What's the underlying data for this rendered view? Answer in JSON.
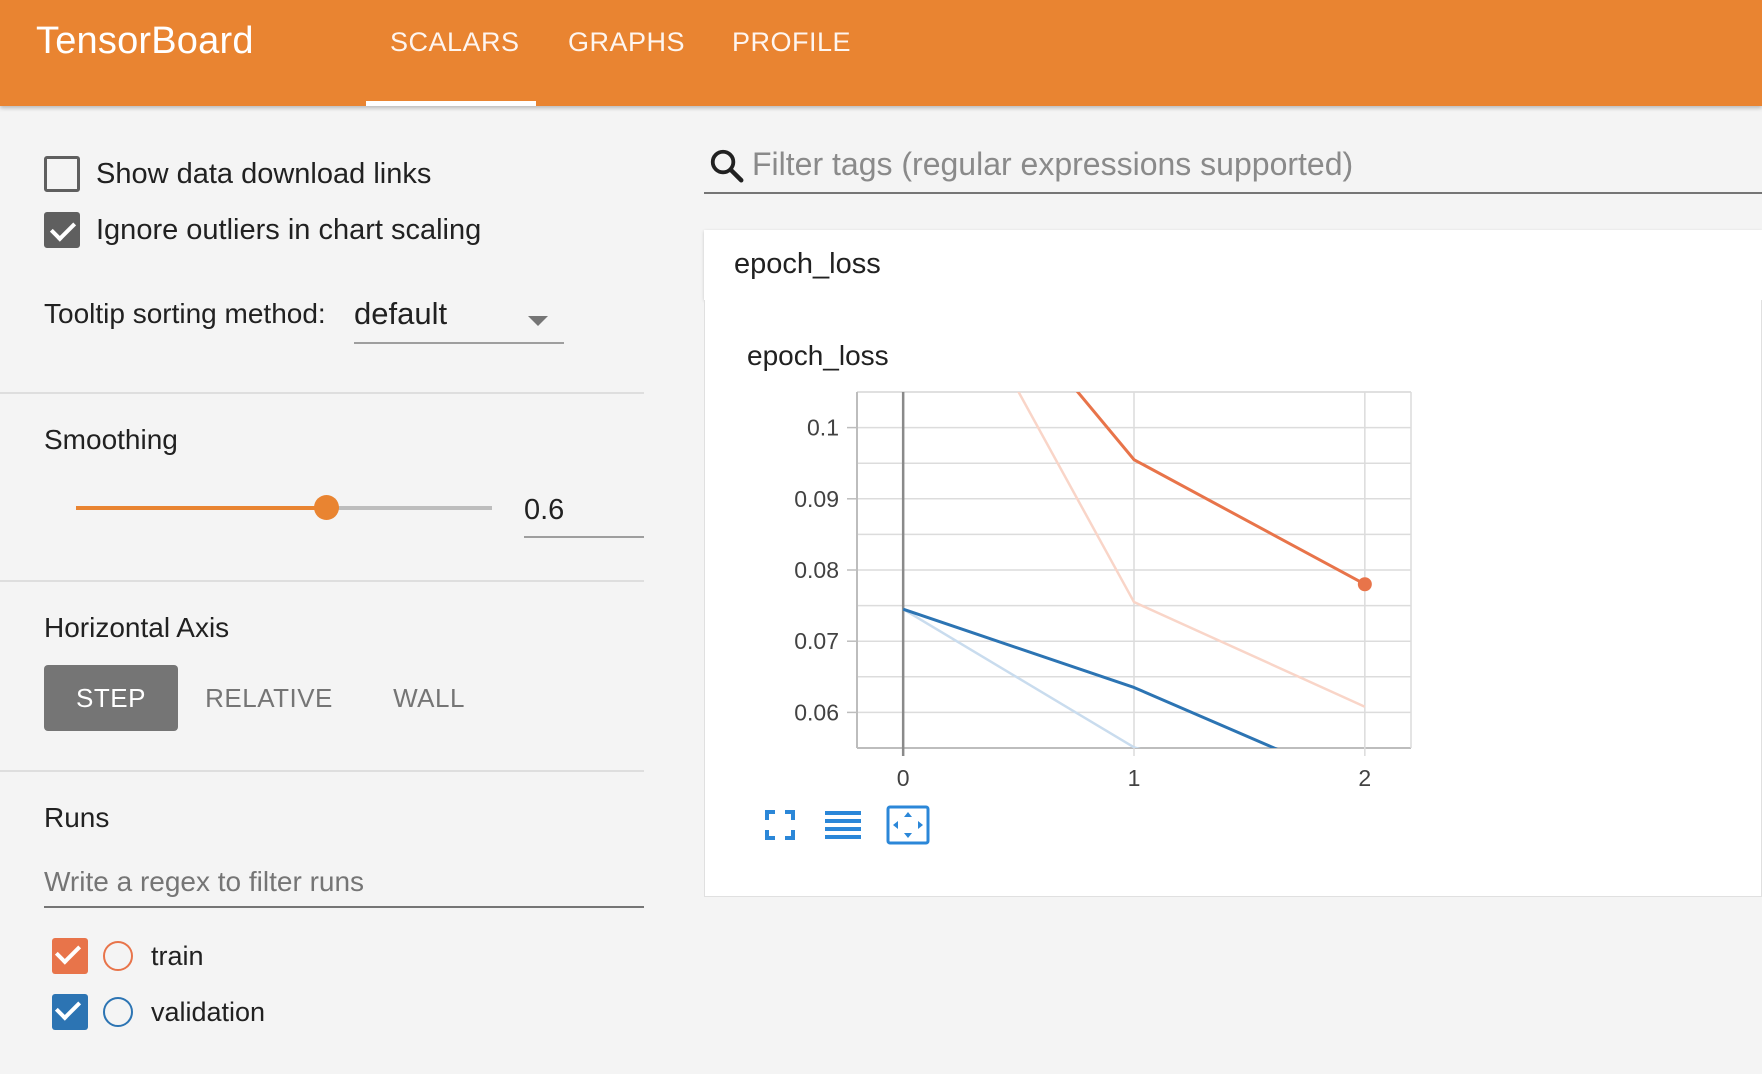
{
  "header": {
    "brand": "TensorBoard",
    "tabs": [
      {
        "label": "SCALARS",
        "active": true
      },
      {
        "label": "GRAPHS",
        "active": false
      },
      {
        "label": "PROFILE",
        "active": false
      }
    ],
    "background_color": "#e98431"
  },
  "sidebar": {
    "options": [
      {
        "label": "Show data download links",
        "checked": false
      },
      {
        "label": "Ignore outliers in chart scaling",
        "checked": true
      }
    ],
    "tooltip_sorting": {
      "label": "Tooltip sorting method:",
      "value": "default"
    },
    "smoothing": {
      "title": "Smoothing",
      "value": "0.6",
      "slider_fraction": 0.6
    },
    "horizontal_axis": {
      "title": "Horizontal Axis",
      "options": [
        "STEP",
        "RELATIVE",
        "WALL"
      ],
      "selected": "STEP"
    },
    "runs": {
      "title": "Runs",
      "filter_placeholder": "Write a regex to filter runs",
      "items": [
        {
          "name": "train",
          "checked": true,
          "color": "#e8744a"
        },
        {
          "name": "validation",
          "checked": true,
          "color": "#2c74b3"
        }
      ]
    }
  },
  "main": {
    "search_placeholder": "Filter tags (regular expressions supported)",
    "card_title": "epoch_loss",
    "toolbar_icons": [
      "fullscreen-icon",
      "list-icon",
      "fit-domain-icon"
    ]
  },
  "chart_data": {
    "type": "line",
    "title": "epoch_loss",
    "xlabel": "",
    "ylabel": "",
    "x_ticks": [
      0,
      1,
      2
    ],
    "y_ticks": [
      0.06,
      0.07,
      0.08,
      0.09,
      0.1
    ],
    "xlim": [
      -0.2,
      2.2
    ],
    "ylim": [
      0.055,
      0.105
    ],
    "grid": true,
    "series": [
      {
        "name": "train",
        "color": "#e8744a",
        "smoothed": true,
        "x": [
          0,
          1,
          2
        ],
        "y": [
          0.1345,
          0.0955,
          0.078
        ]
      },
      {
        "name": "train",
        "color": "#f9d5c8",
        "smoothed": false,
        "x": [
          0,
          1,
          2
        ],
        "y": [
          0.1345,
          0.0755,
          0.0608
        ]
      },
      {
        "name": "validation",
        "color": "#2c74b3",
        "smoothed": true,
        "x": [
          0,
          1,
          2
        ],
        "y": [
          0.0745,
          0.0635,
          0.0495
        ]
      },
      {
        "name": "validation",
        "color": "#c9dcee",
        "smoothed": false,
        "x": [
          0,
          1,
          2
        ],
        "y": [
          0.0745,
          0.0551,
          0.0452
        ]
      }
    ]
  }
}
